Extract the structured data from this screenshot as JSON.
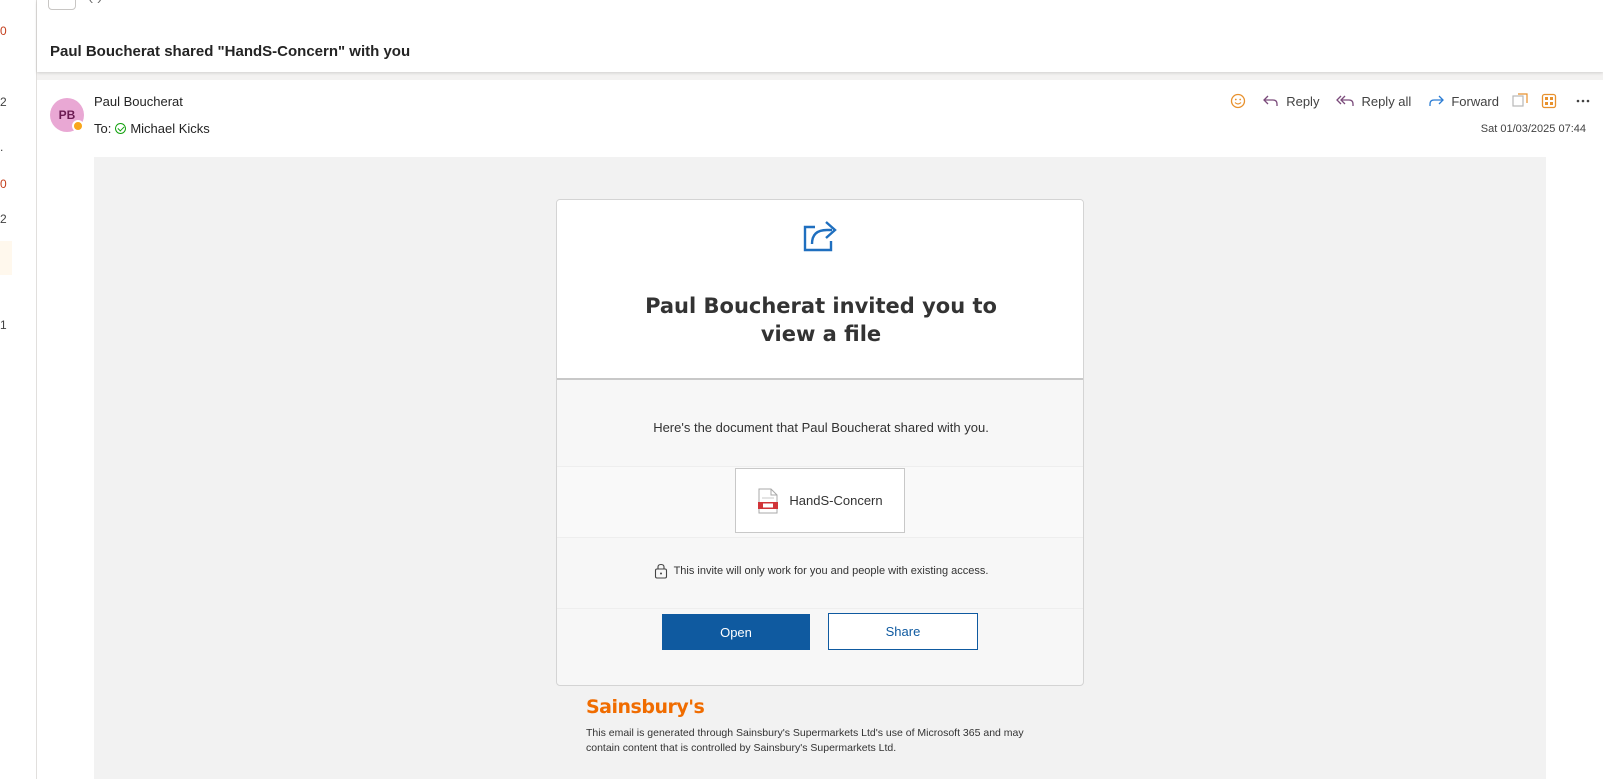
{
  "left_strip": {
    "numbers": [
      {
        "text": "0",
        "orange": true
      },
      {
        "text": "2",
        "orange": false
      },
      {
        "text": ".",
        "orange": false
      },
      {
        "text": "0",
        "orange": true
      },
      {
        "text": "2",
        "orange": false
      },
      {
        "text": "1",
        "orange": false
      }
    ]
  },
  "subject": "Paul Boucherat shared \"HandS-Concern\" with you",
  "message": {
    "avatar_initials": "PB",
    "sender": "Paul Boucherat",
    "to_label": "To:",
    "recipient": "Michael Kicks",
    "date": "Sat 01/03/2025 07:44",
    "actions": {
      "reply": "Reply",
      "reply_all": "Reply all",
      "forward": "Forward"
    }
  },
  "email_body": {
    "invite_title": "Paul Boucherat invited you to view a file",
    "description": "Here's the document that Paul Boucherat shared with you.",
    "file_name": "HandS-Concern",
    "access_note": "This invite will only work for you and people with existing access.",
    "open_label": "Open",
    "share_label": "Share",
    "brand": "Sainsbury's",
    "footer": "This email is generated through Sainsbury's Supermarkets Ltd's use of Microsoft 365 and may contain content that is controlled by Sainsbury's Supermarkets Ltd."
  },
  "colors": {
    "accent_blue": "#0f5aa0",
    "brand_orange": "#f06c00",
    "avatar_bg": "#e9a8d4"
  }
}
